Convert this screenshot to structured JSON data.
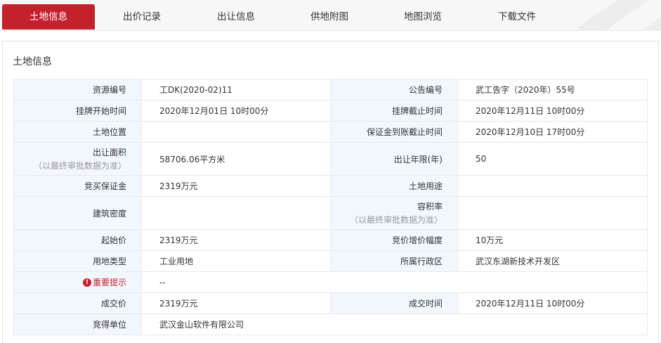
{
  "tabs": [
    {
      "label": "土地信息"
    },
    {
      "label": "出价记录"
    },
    {
      "label": "出让信息"
    },
    {
      "label": "供地附图"
    },
    {
      "label": "地图浏览"
    },
    {
      "label": "下载文件"
    }
  ],
  "active_tab": "土地信息",
  "accent_color": "#c4212d",
  "panel": {
    "title": "土地信息"
  },
  "rows": {
    "r1": {
      "l1": "资源编号",
      "v1": "工DK(2020-02)11",
      "l2": "公告编号",
      "v2": "武工告字（2020年）55号"
    },
    "r2": {
      "l1": "挂牌开始时间",
      "v1": "2020年12月01日 10时00分",
      "l2": "挂牌截止时间",
      "v2": "2020年12月11日 10时00分"
    },
    "r3": {
      "l1": "土地位置",
      "v1": "",
      "l2": "保证金到账截止时间",
      "v2": "2020年12月10日 17时00分"
    },
    "r4": {
      "l1": "出让面积",
      "l1_note": "（以最终审批数据为准）",
      "v1": "58706.06平方米",
      "l2": "出让年限(年)",
      "v2": "50"
    },
    "r5": {
      "l1": "竞买保证金",
      "v1": "2319万元",
      "l2": "土地用途",
      "v2": ""
    },
    "r6": {
      "l1": "建筑密度",
      "v1": "",
      "l2": "容积率",
      "l2_note": "（以最终审批数据为准）",
      "v2": ""
    },
    "r7": {
      "l1": "起始价",
      "v1": "2319万元",
      "l2": "竞价增价幅度",
      "v2": "10万元"
    },
    "r8": {
      "l1": "用地类型",
      "v1": "工业用地",
      "l2": "所属行政区",
      "v2": "武汉东湖新技术开发区"
    },
    "r9": {
      "l1": "重要提示",
      "l1_icon": "exclamation-circle-icon",
      "v1": "--"
    },
    "r10": {
      "l1": "成交价",
      "v1": "2319万元",
      "l2": "成交时间",
      "v2": "2020年12月11日 10时00分"
    },
    "r11": {
      "l1": "竞得单位",
      "v1": "武汉金山软件有限公司"
    }
  }
}
